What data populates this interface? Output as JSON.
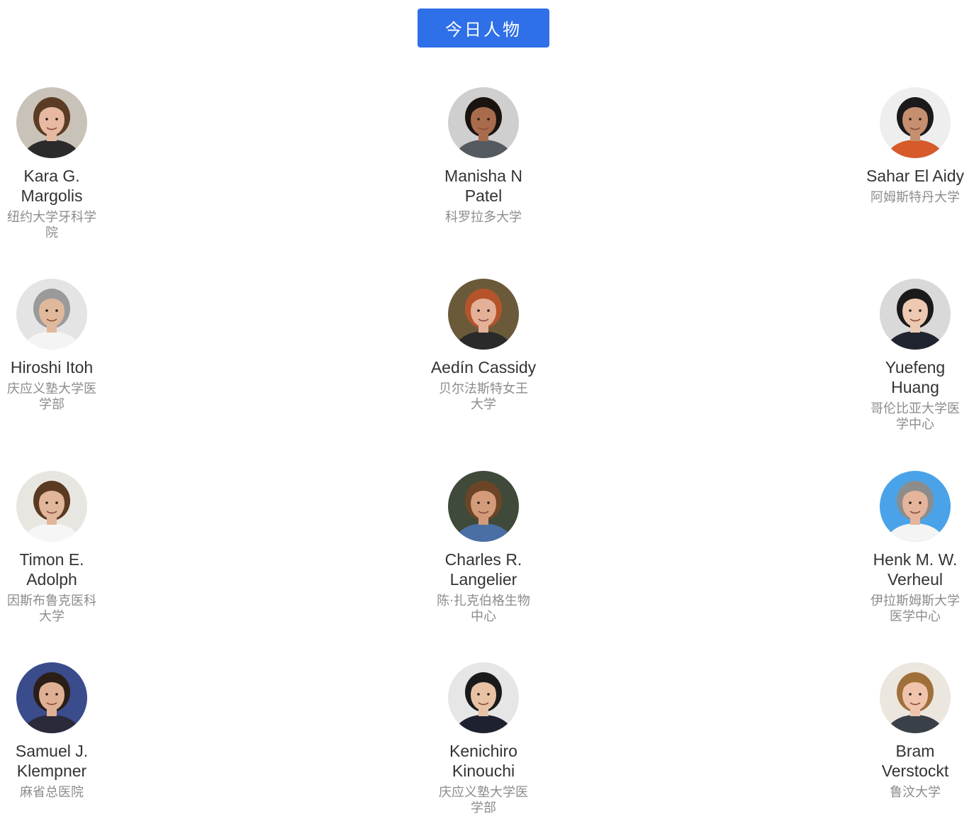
{
  "header": {
    "title": "今日人物"
  },
  "people": [
    {
      "name": "Kara G. Margolis",
      "affiliation": "纽约大学牙科学院",
      "bg": "#c9c2b8",
      "skin": "#e6b9a0",
      "hair": "#5a3b24",
      "cloth": "#2b2b2b"
    },
    {
      "name": "Manisha N Patel",
      "affiliation": "科罗拉多大学",
      "bg": "#cfcfcf",
      "skin": "#a86b4c",
      "hair": "#1a1410",
      "cloth": "#555a60"
    },
    {
      "name": "Sahar El Aidy",
      "affiliation": "阿姆斯特丹大学",
      "bg": "#eeeeee",
      "skin": "#c58f70",
      "hair": "#1a1a1a",
      "cloth": "#d65a2a"
    },
    {
      "name": "Hiroshi Itoh",
      "affiliation": "庆应义塾大学医学部",
      "bg": "#e4e4e4",
      "skin": "#e0b99c",
      "hair": "#9a9a9a",
      "cloth": "#f4f4f4"
    },
    {
      "name": "Aedín Cassidy",
      "affiliation": "贝尔法斯特女王大学",
      "bg": "#6b5a3a",
      "skin": "#e4b098",
      "hair": "#b5542a",
      "cloth": "#2a2a2a"
    },
    {
      "name": "Yuefeng Huang",
      "affiliation": "哥伦比亚大学医学中心",
      "bg": "#d9d9d9",
      "skin": "#ecc9b0",
      "hair": "#1a1a1a",
      "cloth": "#1f2430"
    },
    {
      "name": "Timon E. Adolph",
      "affiliation": "因斯布鲁克医科大学",
      "bg": "#e8e6e0",
      "skin": "#e2b69a",
      "hair": "#5b3a22",
      "cloth": "#f6f6f6"
    },
    {
      "name": "Charles R. Langelier",
      "affiliation": "陈·扎克伯格生物中心",
      "bg": "#3f4a3a",
      "skin": "#d49b7a",
      "hair": "#6b4526",
      "cloth": "#4a6fa5"
    },
    {
      "name": "Henk M. W. Verheul",
      "affiliation": "伊拉斯姆斯大学医学中心",
      "bg": "#4aa3e8",
      "skin": "#e4b49c",
      "hair": "#8c8c8c",
      "cloth": "#f4f4f4"
    },
    {
      "name": "Samuel J. Klempner",
      "affiliation": "麻省总医院",
      "bg": "#3a4c8c",
      "skin": "#e0b094",
      "hair": "#2a1e16",
      "cloth": "#2a2a3a"
    },
    {
      "name": "Kenichiro Kinouchi",
      "affiliation": "庆应义塾大学医学部",
      "bg": "#e6e6e6",
      "skin": "#e8c2a4",
      "hair": "#1a1a1a",
      "cloth": "#1e2230"
    },
    {
      "name": "Bram Verstockt",
      "affiliation": "鲁汶大学",
      "bg": "#ebe6de",
      "skin": "#f0c4ac",
      "hair": "#a0703a",
      "cloth": "#3a4048"
    }
  ]
}
